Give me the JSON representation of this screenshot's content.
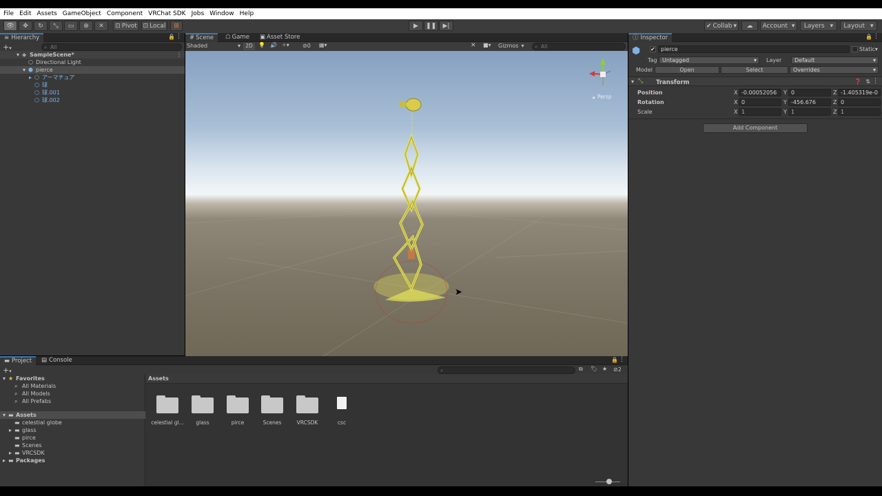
{
  "menu": [
    "File",
    "Edit",
    "Assets",
    "GameObject",
    "Component",
    "VRChat SDK",
    "Jobs",
    "Window",
    "Help"
  ],
  "toolbar": {
    "pivot": "Pivot",
    "local": "Local",
    "collab": "Collab",
    "account": "Account",
    "layers": "Layers",
    "layout": "Layout"
  },
  "hierarchy": {
    "tab": "Hierarchy",
    "search_placeholder": "All",
    "items": [
      {
        "label": "SampleScene*",
        "bold": true
      },
      {
        "label": "Directional Light"
      },
      {
        "label": "pierce",
        "selected": true
      },
      {
        "label": "アーマチュア"
      },
      {
        "label": "球"
      },
      {
        "label": "球.001"
      },
      {
        "label": "球.002"
      }
    ]
  },
  "scene": {
    "tabs": [
      "Scene",
      "Game",
      "Asset Store"
    ],
    "shading": "Shaded",
    "mode_2d": "2D",
    "hidden_count": "0",
    "gizmos": "Gizmos",
    "search_placeholder": "All",
    "persp": "Persp"
  },
  "inspector": {
    "tab": "Inspector",
    "object_name": "pierce",
    "static": "Static",
    "tag_label": "Tag",
    "tag_value": "Untagged",
    "layer_label": "Layer",
    "layer_value": "Default",
    "model_label": "Model",
    "open": "Open",
    "select": "Select",
    "overrides": "Overrides",
    "transform": "Transform",
    "position_label": "Position",
    "rotation_label": "Rotation",
    "scale_label": "Scale",
    "position": {
      "x": "-0.00052056",
      "y": "0",
      "z": "-1.405319e-0"
    },
    "rotation": {
      "x": "0",
      "y": "-456.676",
      "z": "0"
    },
    "scale": {
      "x": "1",
      "y": "1",
      "z": "1"
    },
    "add_component": "Add Component"
  },
  "project": {
    "tabs": [
      "Project",
      "Console"
    ],
    "favorites": "Favorites",
    "fav_items": [
      "All Materials",
      "All Models",
      "All Prefabs"
    ],
    "assets": "Assets",
    "asset_tree": [
      "celestial globe",
      "glass",
      "pirce",
      "Scenes",
      "VRCSDK"
    ],
    "packages": "Packages",
    "assets_header": "Assets",
    "hidden_count": "2",
    "grid": [
      {
        "label": "celestial gl...",
        "kind": "folder"
      },
      {
        "label": "glass",
        "kind": "folder"
      },
      {
        "label": "pirce",
        "kind": "folder"
      },
      {
        "label": "Scenes",
        "kind": "folder"
      },
      {
        "label": "VRCSDK",
        "kind": "folder"
      },
      {
        "label": "csc",
        "kind": "file"
      }
    ]
  },
  "colors": {
    "accent": "#3a79bb",
    "selection": "#2c5d87",
    "panel": "#383838",
    "object_yellow": "#e6e25a"
  }
}
